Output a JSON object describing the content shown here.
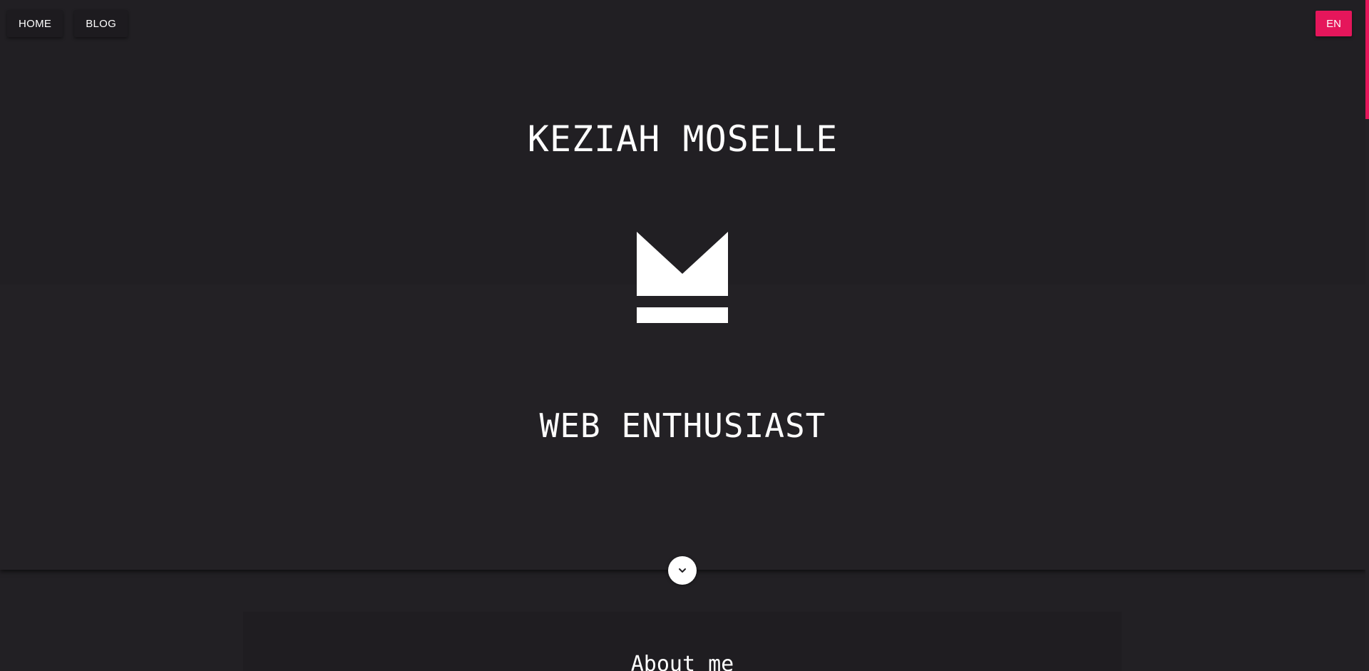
{
  "nav": {
    "items": [
      {
        "label": "HOME"
      },
      {
        "label": "BLOG"
      }
    ],
    "language": "EN"
  },
  "hero": {
    "title": "KEZIAH MOSELLE",
    "subtitle": "WEB ENTHUSIAST",
    "logo_icon": "km-monogram-logo",
    "scroll_icon": "chevron-down-icon"
  },
  "about": {
    "title": "About me"
  },
  "colors": {
    "accent": "#e5165b",
    "background": "#222024",
    "text": "#ffffff"
  }
}
